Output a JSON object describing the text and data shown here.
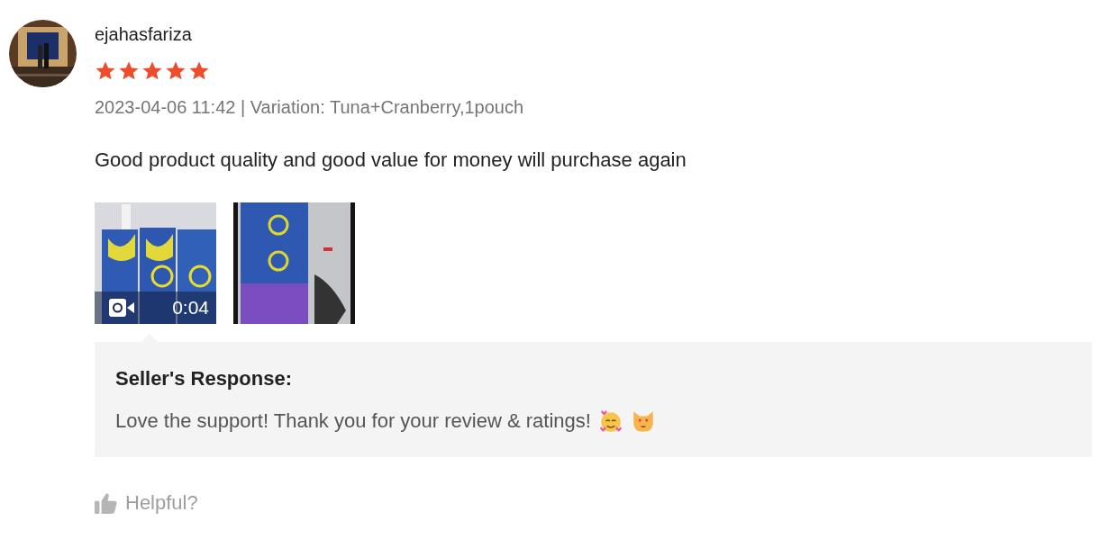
{
  "review": {
    "username": "ejahasfariza",
    "stars": 5,
    "meta": "2023-04-06 11:42 | Variation: Tuna+Cranberry,1pouch",
    "comment": "Good product quality and good value for money will purchase again",
    "media": [
      {
        "kind": "video",
        "duration": "0:04"
      },
      {
        "kind": "picture"
      }
    ],
    "seller_response": {
      "title": "Seller's Response:",
      "text": "Love the support! Thank you for your review & ratings!"
    },
    "helpful": "Helpful?"
  }
}
